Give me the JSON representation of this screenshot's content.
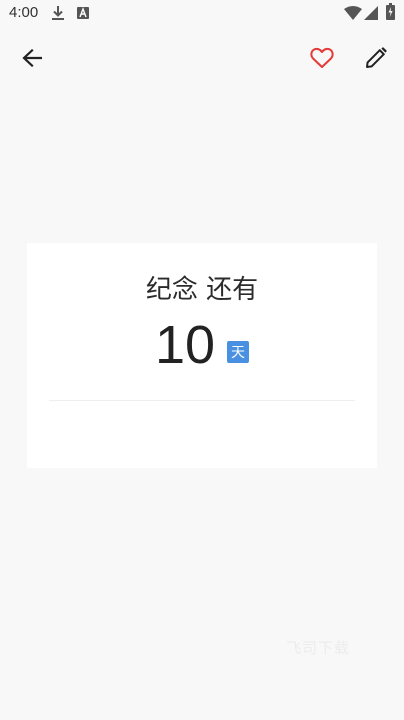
{
  "status_bar": {
    "time": "4:00",
    "icons": [
      "download-icon",
      "a-badge-icon",
      "wifi-icon",
      "signal-icon",
      "battery-icon"
    ]
  },
  "app_bar": {
    "back_icon": "arrow-left-icon",
    "favorite_icon": "heart-outline-icon",
    "edit_icon": "pencil-icon",
    "favorite_color": "#e53935"
  },
  "card": {
    "title": "纪念 还有",
    "count": "10",
    "unit": "天",
    "unit_color": "#4a90e2"
  },
  "watermark": "飞司下载"
}
